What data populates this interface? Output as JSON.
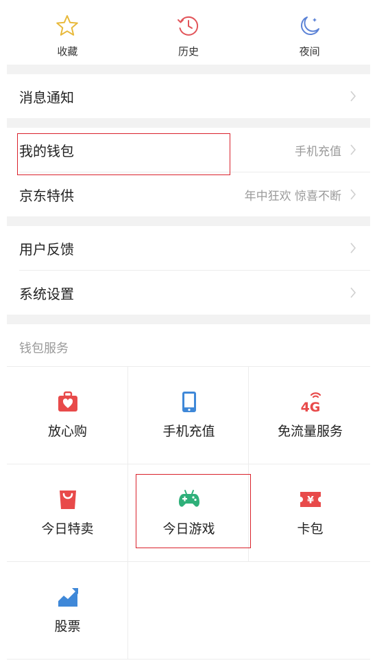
{
  "quick": [
    {
      "label": "收藏",
      "icon": "star-icon"
    },
    {
      "label": "历史",
      "icon": "clock-icon"
    },
    {
      "label": "夜间",
      "icon": "moon-icon"
    }
  ],
  "menu": {
    "notify": {
      "title": "消息通知"
    },
    "wallet": {
      "title": "我的钱包",
      "hint": "手机充值"
    },
    "jd": {
      "title": "京东特供",
      "hint": "年中狂欢 惊喜不断"
    },
    "feedback": {
      "title": "用户反馈"
    },
    "settings": {
      "title": "系统设置"
    }
  },
  "wallet_services": {
    "label": "钱包服务",
    "items": [
      {
        "label": "放心购",
        "icon": "heart-bag-icon"
      },
      {
        "label": "手机充值",
        "icon": "phone-icon"
      },
      {
        "label": "免流量服务",
        "icon": "4g-icon",
        "icon_text": "4G"
      },
      {
        "label": "今日特卖",
        "icon": "shopping-bag-icon"
      },
      {
        "label": "今日游戏",
        "icon": "gamepad-icon"
      },
      {
        "label": "卡包",
        "icon": "ticket-icon",
        "icon_text": "¥"
      },
      {
        "label": "股票",
        "icon": "stock-chart-icon"
      }
    ]
  },
  "colors": {
    "star": "#e8b93b",
    "clock": "#e2555a",
    "moon": "#5b82d6",
    "red": "#e84a4a",
    "blue": "#3f88d8",
    "green": "#2fb07a",
    "highlight": "#d9202a"
  }
}
